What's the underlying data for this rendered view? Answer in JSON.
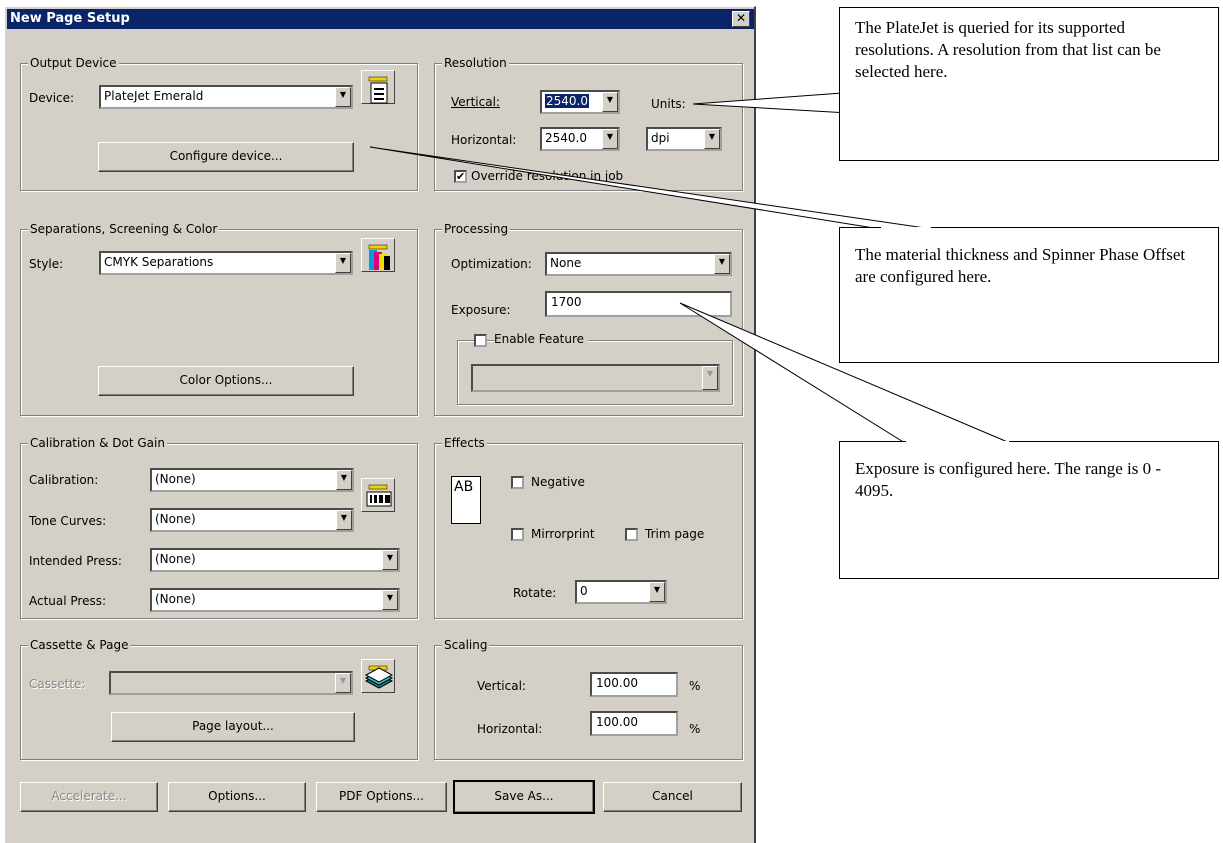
{
  "dialog": {
    "title": "New Page Setup",
    "close_label": "✕"
  },
  "output_device": {
    "group_title": "Output Device",
    "device_label": "Device:",
    "device_value": "PlateJet Emerald",
    "configure_label": "Configure device..."
  },
  "resolution": {
    "group_title": "Resolution",
    "vertical_label": "Vertical:",
    "vertical_value": "2540.0",
    "units_label": "Units:",
    "horizontal_label": "Horizontal:",
    "horizontal_value": "2540.0",
    "units_value": "dpi",
    "override_label": "Override resolution in job",
    "override_checked": "✔"
  },
  "separations": {
    "group_title": "Separations, Screening & Color",
    "style_label": "Style:",
    "style_value": "CMYK Separations",
    "color_options_label": "Color Options..."
  },
  "processing": {
    "group_title": "Processing",
    "optimization_label": "Optimization:",
    "optimization_value": "None",
    "exposure_label": "Exposure:",
    "exposure_value": "1700",
    "enable_feature_label": "Enable Feature",
    "feature_value": ""
  },
  "calibration": {
    "group_title": "Calibration & Dot Gain",
    "calibration_label": "Calibration:",
    "calibration_value": "(None)",
    "tone_curves_label": "Tone Curves:",
    "tone_curves_value": "(None)",
    "intended_press_label": "Intended Press:",
    "intended_press_value": "(None)",
    "actual_press_label": "Actual Press:",
    "actual_press_value": "(None)"
  },
  "effects": {
    "group_title": "Effects",
    "preview_text": "AB",
    "negative_label": "Negative",
    "mirrorprint_label": "Mirrorprint",
    "trim_page_label": "Trim page",
    "rotate_label": "Rotate:",
    "rotate_value": "0"
  },
  "cassette": {
    "group_title": "Cassette & Page",
    "cassette_label": "Cassette:",
    "cassette_value": "",
    "page_layout_label": "Page layout..."
  },
  "scaling": {
    "group_title": "Scaling",
    "vertical_label": "Vertical:",
    "vertical_value": "100.00",
    "horizontal_label": "Horizontal:",
    "horizontal_value": "100.00",
    "percent": "%"
  },
  "footer": {
    "accelerate_label": "Accelerate...",
    "options_label": "Options...",
    "pdf_options_label": "PDF Options...",
    "save_as_label": "Save As...",
    "cancel_label": "Cancel"
  },
  "callouts": {
    "resolution_note": "The PlateJet is queried for its supported resolutions. A resolution from that list can be selected here.",
    "configure_note": "The material thickness and Spinner Phase Offset are configured here.",
    "exposure_note": "Exposure is configured here. The range is 0 - 4095."
  },
  "colors": {
    "title_bar": "#0a246a",
    "dialog_face": "#d4d0c8"
  }
}
